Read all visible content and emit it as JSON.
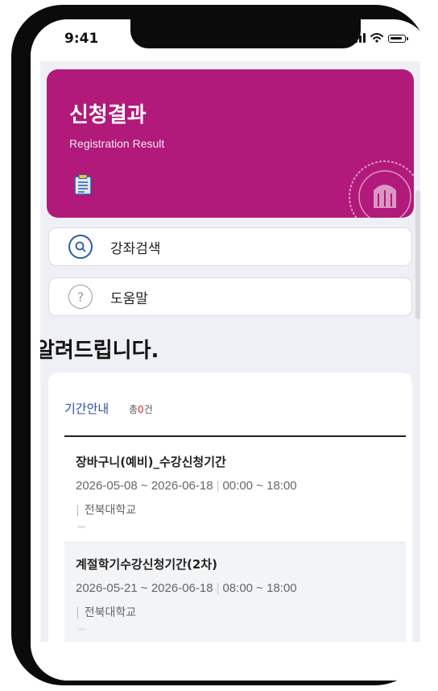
{
  "status_bar": {
    "time": "9:41"
  },
  "hero": {
    "title": "신청결과",
    "subtitle": "Registration Result",
    "icon": "clipboard-icon",
    "watermark": "seal-icon",
    "color": "#b1197a"
  },
  "menu": [
    {
      "label": "강좌검색",
      "icon": "search-icon"
    },
    {
      "label": "도움말",
      "icon": "help-icon",
      "icon_glyph": "?"
    }
  ],
  "notice": {
    "title": "알려드립니다.",
    "section": {
      "heading": "기간안내",
      "count_prefix": "총",
      "count": "0",
      "count_suffix": "건"
    },
    "items": [
      {
        "title": "장바구니(예비)_수강신청기간",
        "date_range": "2026-05-08 ~ 2026-06-18",
        "time_range": "00:00 ~ 18:00",
        "organization": "전북대학교"
      },
      {
        "title": "계절학기수강신청기간(2차)",
        "date_range": "2026-05-21 ~ 2026-06-18",
        "time_range": "08:00 ~ 18:00",
        "organization": "전북대학교"
      }
    ]
  }
}
